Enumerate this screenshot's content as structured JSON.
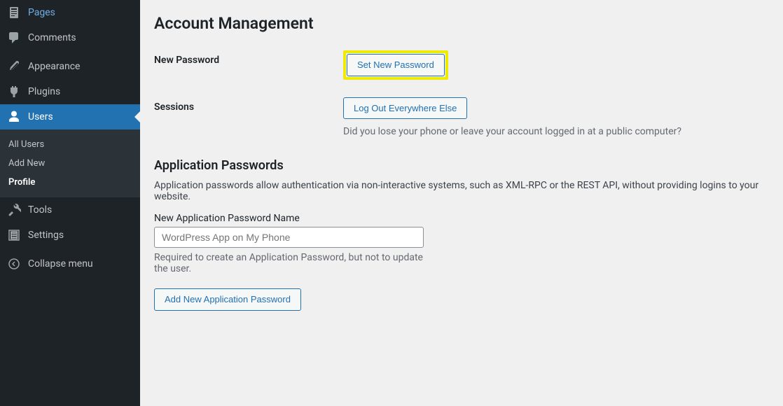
{
  "sidebar": {
    "items": [
      {
        "label": "Pages"
      },
      {
        "label": "Comments"
      },
      {
        "label": "Appearance"
      },
      {
        "label": "Plugins"
      },
      {
        "label": "Users"
      },
      {
        "label": "Tools"
      },
      {
        "label": "Settings"
      },
      {
        "label": "Collapse menu"
      }
    ],
    "submenu": [
      {
        "label": "All Users"
      },
      {
        "label": "Add New"
      },
      {
        "label": "Profile"
      }
    ]
  },
  "content": {
    "account_heading": "Account Management",
    "new_password_label": "New Password",
    "set_new_password_button": "Set New Password",
    "sessions_label": "Sessions",
    "logout_button": "Log Out Everywhere Else",
    "sessions_description": "Did you lose your phone or leave your account logged in at a public computer?",
    "app_passwords_heading": "Application Passwords",
    "app_passwords_description": "Application passwords allow authentication via non-interactive systems, such as XML-RPC or the REST API, without providing logins to your website.",
    "new_app_password_label": "New Application Password Name",
    "new_app_password_placeholder": "WordPress App on My Phone",
    "new_app_password_help": "Required to create an Application Password, but not to update the user.",
    "add_app_password_button": "Add New Application Password"
  }
}
